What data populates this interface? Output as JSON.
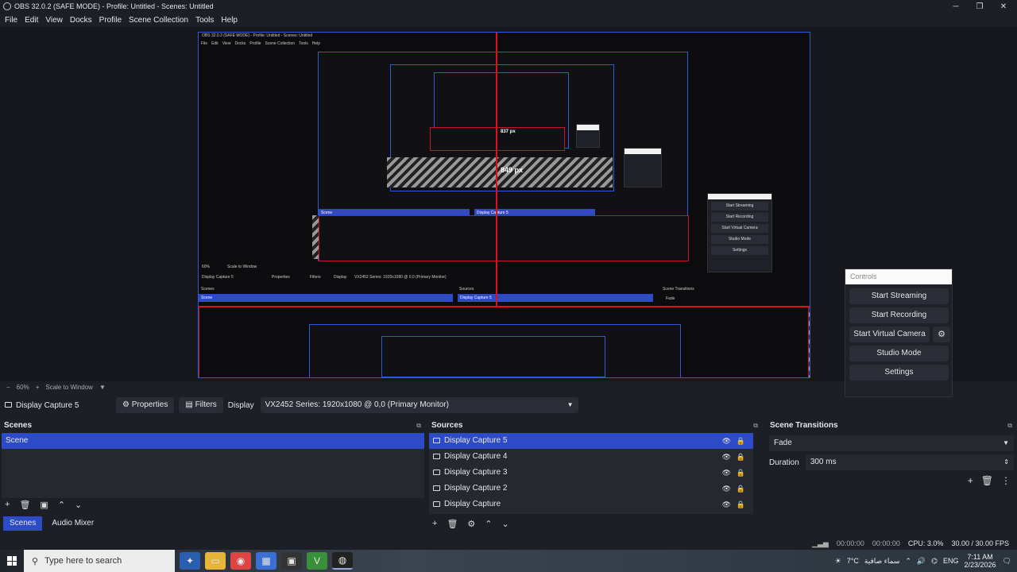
{
  "window": {
    "title": "OBS 32.0.2 (SAFE MODE) - Profile: Untitled - Scenes: Untitled",
    "minimize": "─",
    "maximize": "❐",
    "close": "✕"
  },
  "menu": [
    "File",
    "Edit",
    "View",
    "Docks",
    "Profile",
    "Scene Collection",
    "Tools",
    "Help"
  ],
  "preview": {
    "nested_title": "OBS 32.0.2 (SAFE MODE) - Profile: Untitled - Scenes: Untitled",
    "measure_label_1": "849 px",
    "measure_label_2": "837 px",
    "nested_dock_scenes": "Scenes",
    "nested_dock_sources": "Sources",
    "nested_dock_transitions": "Scene Transitions",
    "nested_scene_item": "Scene",
    "nested_source_item": "Display Capture 5",
    "nested_fade": "Fade",
    "nested_display_capture": "Display Capture 5",
    "nested_properties": "Properties",
    "nested_filters": "Filters",
    "nested_display_label": "Display",
    "nested_display_value": "VX2452 Series: 1920x1080 @ 0,0 (Primary Monitor)",
    "nested_zoom": "60%",
    "nested_scale": "Scale to Window"
  },
  "controls": {
    "header": "Controls",
    "start_streaming": "Start Streaming",
    "start_recording": "Start Recording",
    "start_virtual_camera": "Start Virtual Camera",
    "studio_mode": "Studio Mode",
    "settings": "Settings",
    "gear_icon": "⚙"
  },
  "zoom": {
    "minus": "−",
    "value": "60%",
    "plus": "+",
    "scale": "Scale to Window",
    "dropdown": "▼"
  },
  "source_toolbar": {
    "source_name": "Display Capture 5",
    "properties": "Properties",
    "filters": "Filters",
    "display_label": "Display",
    "display_value": "VX2452 Series: 1920x1080 @ 0,0 (Primary Monitor)"
  },
  "scenes_dock": {
    "title": "Scenes",
    "items": [
      "Scene"
    ]
  },
  "sources_dock": {
    "title": "Sources",
    "items": [
      "Display Capture 5",
      "Display Capture 4",
      "Display Capture 3",
      "Display Capture 2",
      "Display Capture"
    ]
  },
  "transitions_dock": {
    "title": "Scene Transitions",
    "transition": "Fade",
    "duration_label": "Duration",
    "duration_value": "300 ms"
  },
  "tabs": [
    "Scenes",
    "Audio Mixer"
  ],
  "status": {
    "stream_time": "00:00:00",
    "record_time": "00:00:00",
    "cpu": "CPU: 3.0%",
    "fps": "30.00 / 30.00 FPS"
  },
  "taskbar": {
    "search_placeholder": "Type here to search",
    "weather": "7°C",
    "weather_text": "سماء صافية",
    "language": "ENG",
    "time": "7:11 AM",
    "date": "2/23/2026"
  }
}
